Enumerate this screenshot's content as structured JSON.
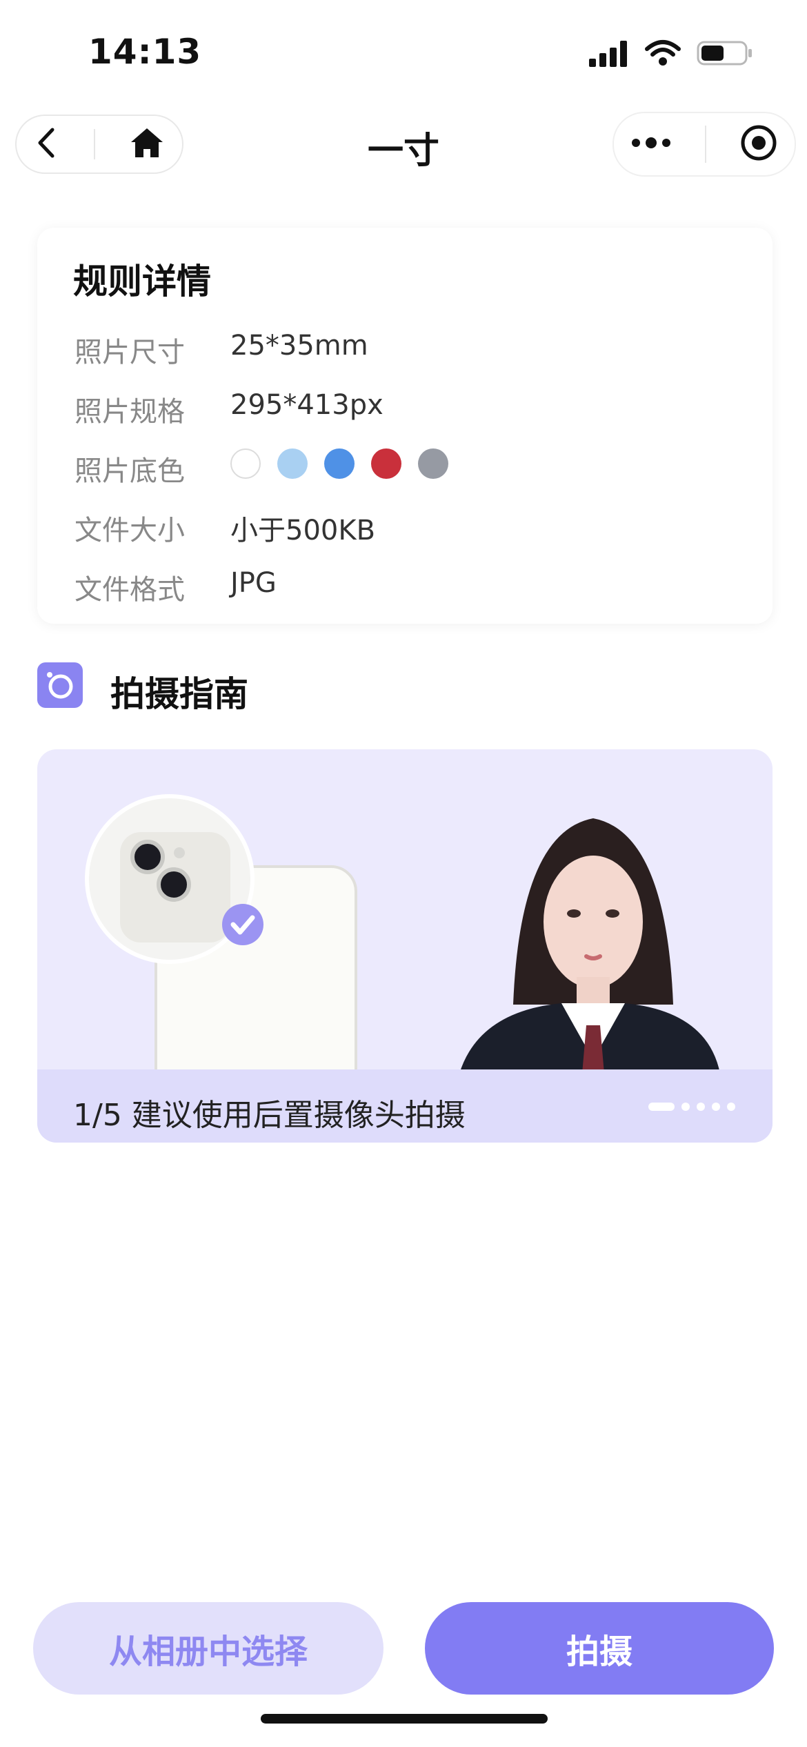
{
  "status_bar": {
    "time": "14:13"
  },
  "nav": {
    "title": "一寸"
  },
  "rules": {
    "title": "规则详情",
    "rows": [
      {
        "label": "照片尺寸",
        "value": "25*35mm"
      },
      {
        "label": "照片规格",
        "value": "295*413px"
      },
      {
        "label": "照片底色",
        "value": ""
      },
      {
        "label": "文件大小",
        "value": "小于500KB"
      },
      {
        "label": "文件格式",
        "value": "JPG"
      }
    ],
    "background_colors": [
      "#ffffff",
      "#a9d0f2",
      "#4f91e6",
      "#c9303b",
      "#969aa3"
    ]
  },
  "guide": {
    "title": "拍摄指南",
    "caption": "1/5 建议使用后置摄像头拍摄",
    "accent": "#8a84f1",
    "dots_count": 5,
    "active_dot": 1
  },
  "buttons": {
    "album": "从相册中选择",
    "shoot": "拍摄"
  },
  "colors": {
    "primary": "#827cf3",
    "primary_light": "#e2e0fb",
    "guide_bg": "#eceafd"
  }
}
